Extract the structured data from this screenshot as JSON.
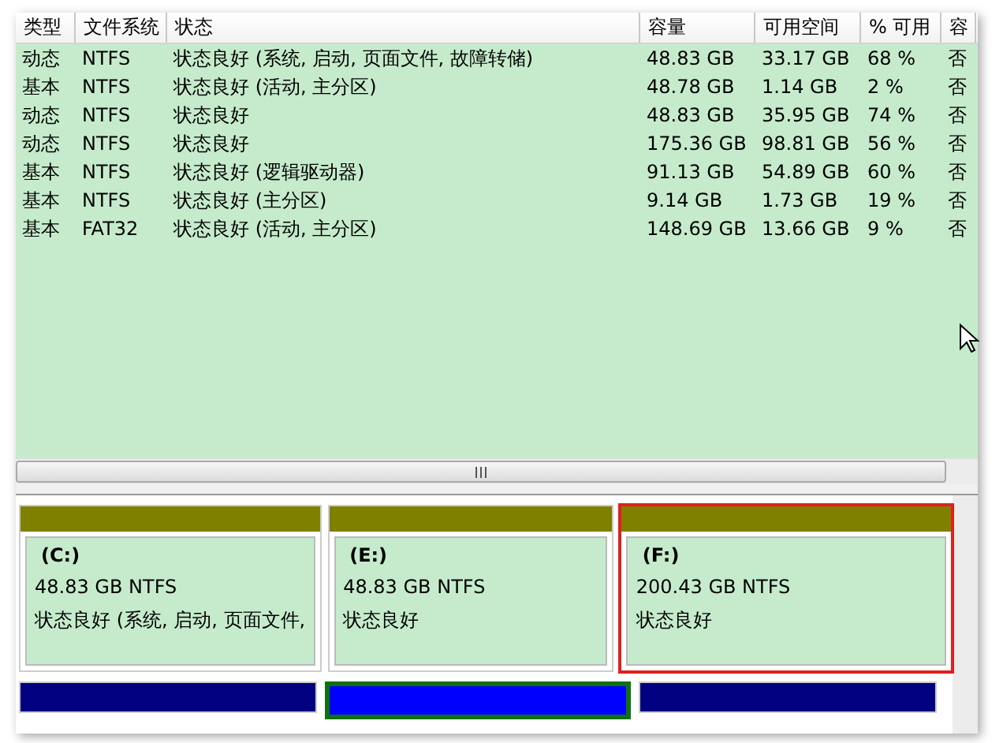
{
  "volume_table": {
    "columns": [
      "类型",
      "文件系统",
      "状态",
      "容量",
      "可用空间",
      "% 可用",
      "容"
    ],
    "rows": [
      [
        "动态",
        "NTFS",
        "状态良好 (系统, 启动, 页面文件, 故障转储)",
        "48.83 GB",
        "33.17 GB",
        "68 %",
        "否"
      ],
      [
        "基本",
        "NTFS",
        "状态良好 (活动, 主分区)",
        "48.78 GB",
        "1.14 GB",
        "2 %",
        "否"
      ],
      [
        "动态",
        "NTFS",
        "状态良好",
        "48.83 GB",
        "35.95 GB",
        "74 %",
        "否"
      ],
      [
        "动态",
        "NTFS",
        "状态良好",
        "175.36 GB",
        "98.81 GB",
        "56 %",
        "否"
      ],
      [
        "基本",
        "NTFS",
        "状态良好 (逻辑驱动器)",
        "91.13 GB",
        "54.89 GB",
        "60 %",
        "否"
      ],
      [
        "基本",
        "NTFS",
        "状态良好 (主分区)",
        "9.14 GB",
        "1.73 GB",
        "19 %",
        "否"
      ],
      [
        "基本",
        "FAT32",
        "状态良好 (活动, 主分区)",
        "148.69 GB",
        "13.66 GB",
        "9 %",
        "否"
      ]
    ]
  },
  "partitions": [
    {
      "letter": "(C:)",
      "size": "48.83 GB NTFS",
      "status": "状态良好 (系统, 启动, 页面文件,",
      "highlighted": false
    },
    {
      "letter": "(E:)",
      "size": "48.83 GB NTFS",
      "status": "状态良好",
      "highlighted": false
    },
    {
      "letter": "(F:)",
      "size": "200.43 GB NTFS",
      "status": "状态良好",
      "highlighted": true
    }
  ],
  "next_disk": [
    {
      "color": "#000080",
      "selected": false
    },
    {
      "color": "#0000ff",
      "selected": true
    },
    {
      "color": "#000080",
      "selected": false
    }
  ]
}
